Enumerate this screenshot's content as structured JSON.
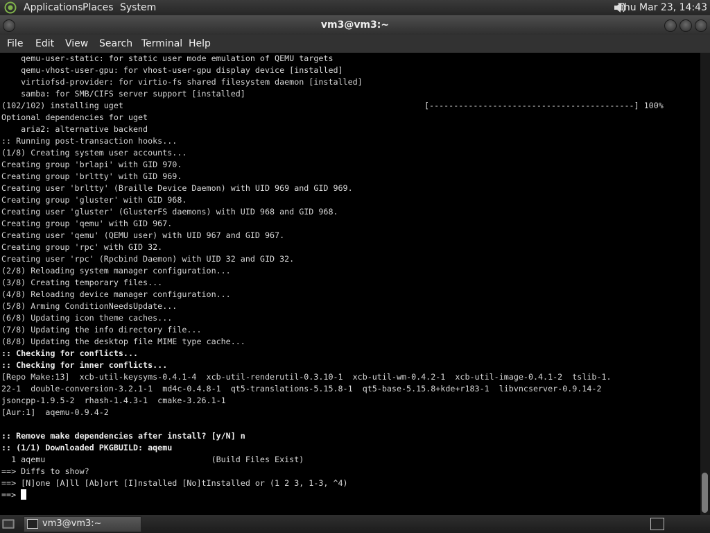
{
  "top_panel": {
    "menus": [
      "Applications",
      "Places",
      "System"
    ],
    "clock": "Thu Mar 23, 14:43"
  },
  "window": {
    "title": "vm3@vm3:~"
  },
  "menubar": {
    "items": [
      "File",
      "Edit",
      "View",
      "Search",
      "Terminal",
      "Help"
    ]
  },
  "terminal": {
    "lines": [
      "    qemu-user-static: for static user mode emulation of QEMU targets",
      "    qemu-vhost-user-gpu: for vhost-user-gpu display device [installed]",
      "    virtiofsd-provider: for virtio-fs shared filesystem daemon [installed]",
      "    samba: for SMB/CIFS server support [installed]",
      "(102/102) installing uget",
      "Optional dependencies for uget",
      "    aria2: alternative backend",
      ":: Running post-transaction hooks...",
      "(1/8) Creating system user accounts...",
      "Creating group 'brlapi' with GID 970.",
      "Creating group 'brltty' with GID 969.",
      "Creating user 'brltty' (Braille Device Daemon) with UID 969 and GID 969.",
      "Creating group 'gluster' with GID 968.",
      "Creating user 'gluster' (GlusterFS daemons) with UID 968 and GID 968.",
      "Creating group 'qemu' with GID 967.",
      "Creating user 'qemu' (QEMU user) with UID 967 and GID 967.",
      "Creating group 'rpc' with GID 32.",
      "Creating user 'rpc' (Rpcbind Daemon) with UID 32 and GID 32.",
      "(2/8) Reloading system manager configuration...",
      "(3/8) Creating temporary files...",
      "(4/8) Reloading device manager configuration...",
      "(5/8) Arming ConditionNeedsUpdate...",
      "(6/8) Updating icon theme caches...",
      "(7/8) Updating the info directory file...",
      "(8/8) Updating the desktop file MIME type cache...",
      ":: Checking for conflicts...",
      ":: Checking for inner conflicts...",
      "[Repo Make:13]  xcb-util-keysyms-0.4.1-4  xcb-util-renderutil-0.3.10-1  xcb-util-wm-0.4.2-1  xcb-util-image-0.4.1-2  tslib-1.",
      "22-1  double-conversion-3.2.1-1  md4c-0.4.8-1  qt5-translations-5.15.8-1  qt5-base-5.15.8+kde+r183-1  libvncserver-0.9.14-2",
      "jsoncpp-1.9.5-2  rhash-1.4.3-1  cmake-3.26.1-1",
      "[Aur:1]  aqemu-0.9.4-2",
      "",
      ":: Remove make dependencies after install? [y/N] n",
      ":: (1/1) Downloaded PKGBUILD: aqemu",
      "  1 aqemu                                  (Build Files Exist)",
      "==> Diffs to show?",
      "==> [N]one [A]ll [Ab]ort [I]nstalled [No]tInstalled or (1 2 3, 1-3, ^4)",
      "==> "
    ],
    "bold_lines": [
      25,
      26,
      32,
      33
    ],
    "progress": "[------------------------------------------] 100%"
  },
  "taskbar": {
    "task_label": "vm3@vm3:~"
  }
}
